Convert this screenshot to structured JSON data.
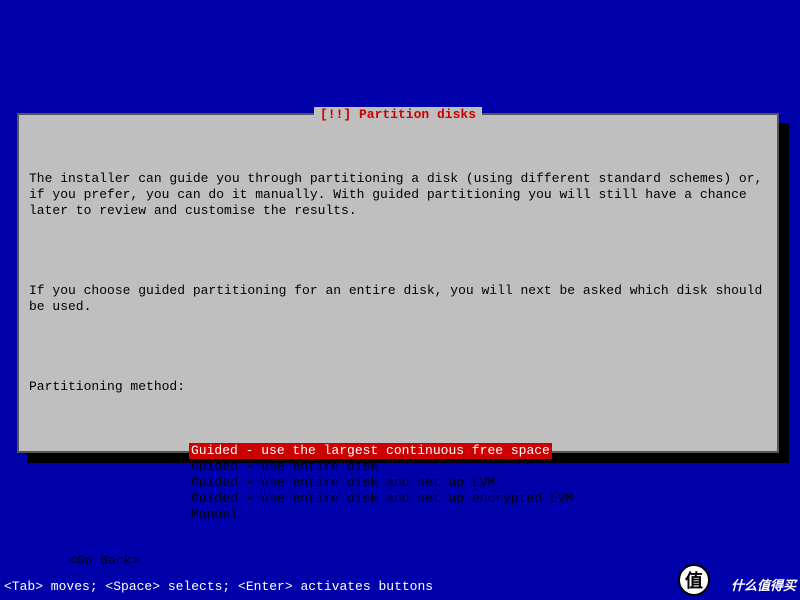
{
  "dialog": {
    "title": "[!!] Partition disks",
    "paragraph1": "The installer can guide you through partitioning a disk (using different standard schemes) or, if you prefer, you can do it manually. With guided partitioning you will still have a chance later to review and customise the results.",
    "paragraph2": "If you choose guided partitioning for an entire disk, you will next be asked which disk should be used.",
    "prompt": "Partitioning method:",
    "options": [
      "Guided - use the largest continuous free space",
      "Guided - use entire disk",
      "Guided - use entire disk and set up LVM",
      "Guided - use entire disk and set up encrypted LVM",
      "Manual"
    ],
    "selected_index": 0,
    "go_back": "<Go Back>"
  },
  "status_bar": "<Tab> moves; <Space> selects; <Enter> activates buttons",
  "watermark": {
    "badge": "值",
    "text": "什么值得买"
  }
}
